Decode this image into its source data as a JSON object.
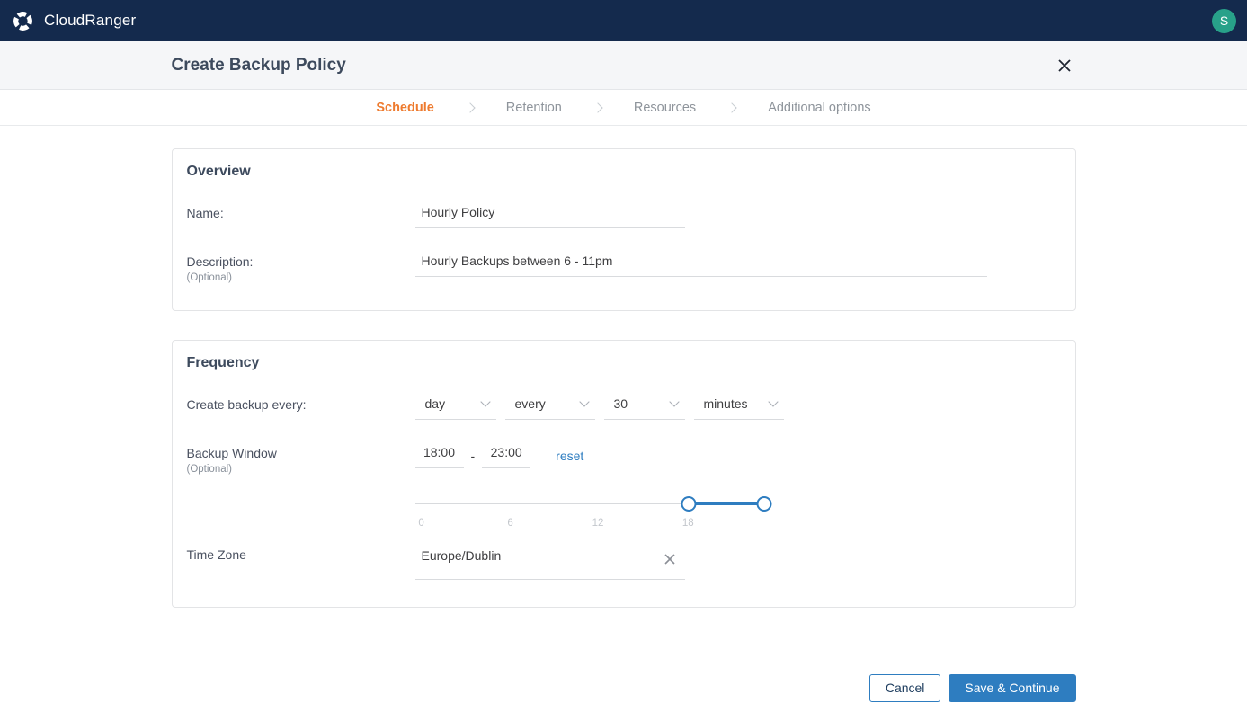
{
  "navbar": {
    "brand": "CloudRanger",
    "avatar_initial": "S"
  },
  "modal": {
    "title": "Create Backup Policy"
  },
  "steps": [
    {
      "label": "Schedule",
      "active": true
    },
    {
      "label": "Retention",
      "active": false
    },
    {
      "label": "Resources",
      "active": false
    },
    {
      "label": "Additional options",
      "active": false
    }
  ],
  "overview": {
    "heading": "Overview",
    "name_label": "Name:",
    "name_value": "Hourly Policy",
    "description_label": "Description:",
    "description_optional": "(Optional)",
    "description_value": "Hourly Backups between 6 - 11pm"
  },
  "frequency": {
    "heading": "Frequency",
    "create_label": "Create backup every:",
    "selects": [
      {
        "value": "day"
      },
      {
        "value": "every"
      },
      {
        "value": "30"
      },
      {
        "value": "minutes"
      }
    ],
    "backup_window_label": "Backup Window",
    "backup_window_optional": "(Optional)",
    "window_start": "18:00",
    "window_separator": "-",
    "window_end": "23:00",
    "reset_label": "reset",
    "slider": {
      "ticks": [
        "0",
        "6",
        "12",
        "18"
      ],
      "selected_start": "18:00",
      "selected_end": "23:00"
    },
    "timezone_label": "Time Zone",
    "timezone_value": "Europe/Dublin"
  },
  "footer": {
    "cancel_label": "Cancel",
    "save_label": "Save & Continue"
  },
  "icons": {
    "logo": "pinwheel-logo-icon",
    "close": "close-icon",
    "step_separator": "chevron-right-icon",
    "dropdown": "chevron-down-icon",
    "timezone_clear": "clear-x-icon"
  },
  "colors": {
    "navbar_bg": "#142a4d",
    "avatar_green": "#28a189",
    "accent_orange": "#ee7b2f",
    "primary_blue": "#2e7dc0",
    "title_text": "#3d4a5d",
    "muted_gray": "#8e949b"
  }
}
